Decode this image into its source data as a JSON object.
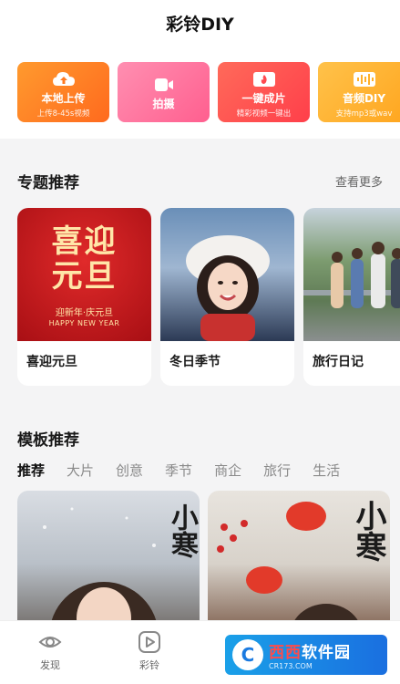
{
  "app": {
    "title": "彩铃DIY"
  },
  "actions": [
    {
      "label": "本地上传",
      "sub": "上传8-45s视频",
      "icon": "cloud-upload-icon"
    },
    {
      "label": "拍摄",
      "sub": "",
      "icon": "camera-icon"
    },
    {
      "label": "一键成片",
      "sub": "精彩视频一键出",
      "icon": "one-click-video-icon"
    },
    {
      "label": "音频DIY",
      "sub": "支持mp3或wav",
      "icon": "audio-wave-icon"
    }
  ],
  "topics": {
    "title": "专题推荐",
    "more": "查看更多",
    "items": [
      {
        "caption": "喜迎元旦",
        "art_title": "喜迎元旦",
        "art_line1": "迎新年·庆元旦",
        "art_line2": "HAPPY NEW YEAR"
      },
      {
        "caption": "冬日季节"
      },
      {
        "caption": "旅行日记"
      }
    ]
  },
  "templates": {
    "title": "模板推荐",
    "tabs": [
      "推荐",
      "大片",
      "创意",
      "季节",
      "商企",
      "旅行",
      "生活"
    ],
    "active_tab": "推荐",
    "items": [
      {
        "art_text": "小寒"
      },
      {
        "art_text": "小寒"
      }
    ]
  },
  "nav": {
    "items": [
      {
        "label": "发现",
        "icon": "eye-icon"
      },
      {
        "label": "彩铃",
        "icon": "play-icon"
      }
    ]
  },
  "watermark": {
    "logo": "C",
    "main_a": "西西",
    "main_b": "软件园",
    "sub": "CR173.COM"
  },
  "colors": {
    "accent": "#ffd33a",
    "upload": "#ff7a22",
    "shoot": "#ff6d99",
    "film": "#ff4a50",
    "audio": "#ffb02a"
  }
}
